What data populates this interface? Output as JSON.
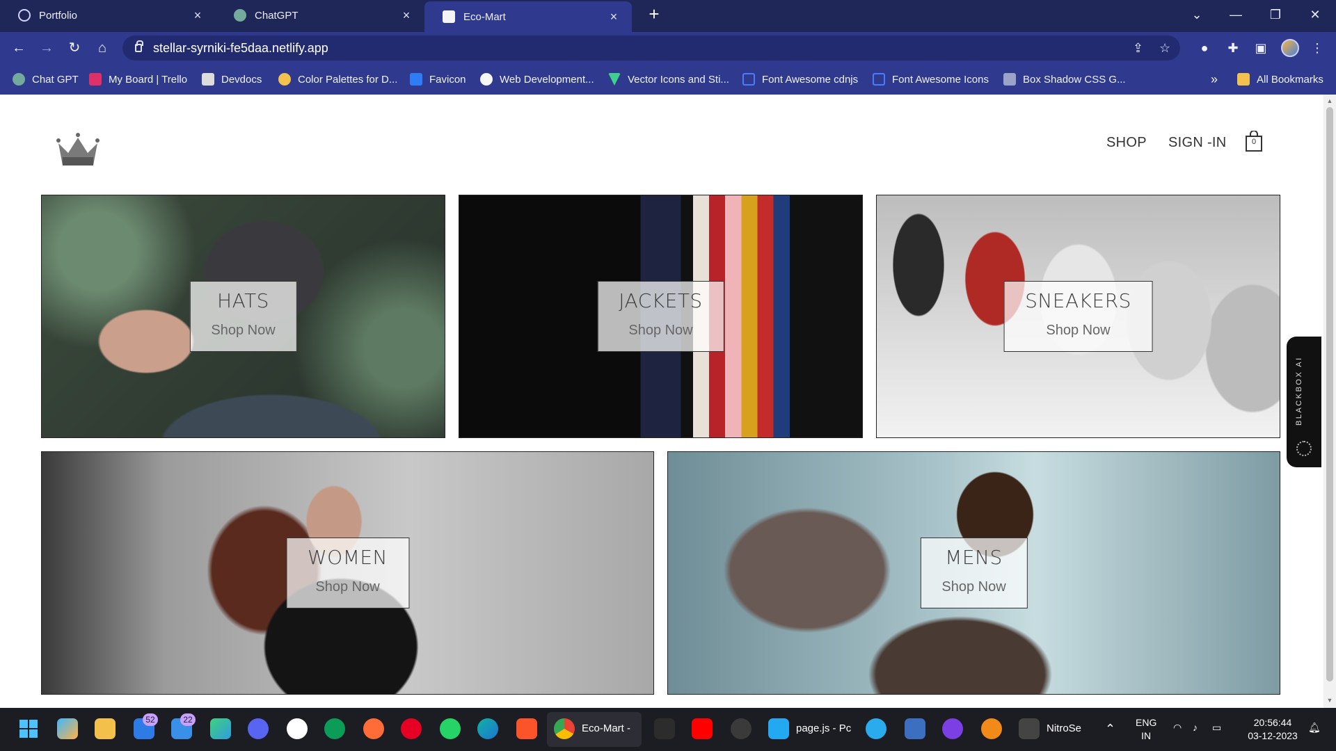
{
  "browser": {
    "tabs": [
      {
        "label": "Portfolio",
        "icon": "globe-icon",
        "active": false
      },
      {
        "label": "ChatGPT",
        "icon": "chatgpt-icon",
        "active": false
      },
      {
        "label": "Eco-Mart",
        "icon": "page-icon",
        "active": true
      }
    ],
    "new_tab": "+",
    "close_glyph": "×",
    "url": "stellar-syrniki-fe5daa.netlify.app",
    "bookmarks": [
      {
        "label": "Chat GPT",
        "color": "#74aa9c"
      },
      {
        "label": "My Board | Trello",
        "color": "#e0306a"
      },
      {
        "label": "Devdocs",
        "color": "#dcdcdc"
      },
      {
        "label": "Color Palettes for D...",
        "color": "#f2c14e"
      },
      {
        "label": "Favicon",
        "color": "#2f7df6"
      },
      {
        "label": "Web Development...",
        "color": "#f7f7f7"
      },
      {
        "label": "Vector Icons and Sti...",
        "color": "#3fcf8e"
      },
      {
        "label": "Font Awesome cdnjs",
        "color": "#4a7cff"
      },
      {
        "label": "Font Awesome Icons",
        "color": "#4a7cff"
      },
      {
        "label": "Box Shadow CSS G...",
        "color": "#9aa4c8"
      }
    ],
    "bookmarks_overflow": "»",
    "all_bookmarks": "All Bookmarks"
  },
  "site": {
    "nav": {
      "shop": "SHOP",
      "signin": "SIGN -IN",
      "cart_count": "0"
    },
    "categories": [
      {
        "title": "HATS",
        "cta": "Shop Now"
      },
      {
        "title": "JACKETS",
        "cta": "Shop Now"
      },
      {
        "title": "SNEAKERS",
        "cta": "Shop Now"
      },
      {
        "title": "WOMEN",
        "cta": "Shop Now"
      },
      {
        "title": "MENS",
        "cta": "Shop Now"
      }
    ],
    "sidebar_widget": "BLACKBOX AI"
  },
  "taskbar": {
    "badges": {
      "teams": "52",
      "mail": "22"
    },
    "chrome_label": "Eco-Mart -",
    "vscode_label": "page.js - Pc",
    "notion_label": "NitroSe",
    "language": {
      "line1": "ENG",
      "line2": "IN"
    },
    "time": "20:56:44",
    "date": "03-12-2023"
  },
  "colors": {
    "tab_strip": "#1f2658",
    "toolbar": "#2f3a8f",
    "taskbar": "#1c1d22"
  }
}
